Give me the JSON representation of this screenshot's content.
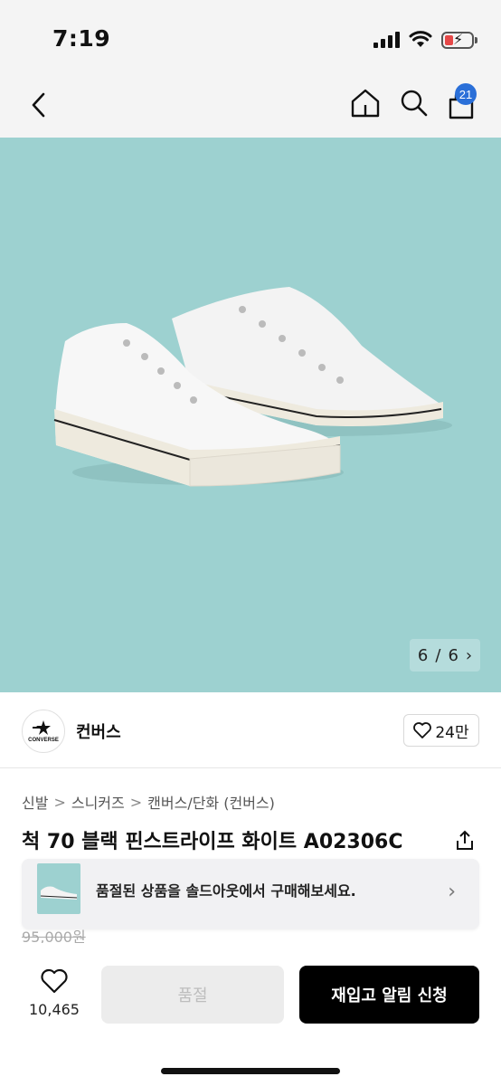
{
  "status_bar": {
    "time": "7:19"
  },
  "header": {
    "cart_count": "21"
  },
  "hero": {
    "counter_current": "6",
    "counter_sep": "/",
    "counter_total": "6",
    "next_glyph": "›"
  },
  "brand": {
    "name": "컨버스",
    "logo_text": "CONVERSE",
    "like_count": "24만"
  },
  "breadcrumb": [
    "신발",
    "스니커즈",
    "캔버스/단화 (컨버스)"
  ],
  "breadcrumb_sep": ">",
  "product": {
    "title": "척 70 블랙 핀스트라이프 화이트 A02306C",
    "old_price": "95,000원"
  },
  "soldout_banner": {
    "text": "품절된 상품을 솔드아웃에서 구매해보세요.",
    "chevron": "›"
  },
  "bottom": {
    "wish_count": "10,465",
    "soldout_label": "품절",
    "restock_label": "재입고 알림 신청"
  },
  "colors": {
    "hero_bg": "#9dd1d0",
    "accent": "#2a6fd8",
    "primary_button": "#000000"
  }
}
